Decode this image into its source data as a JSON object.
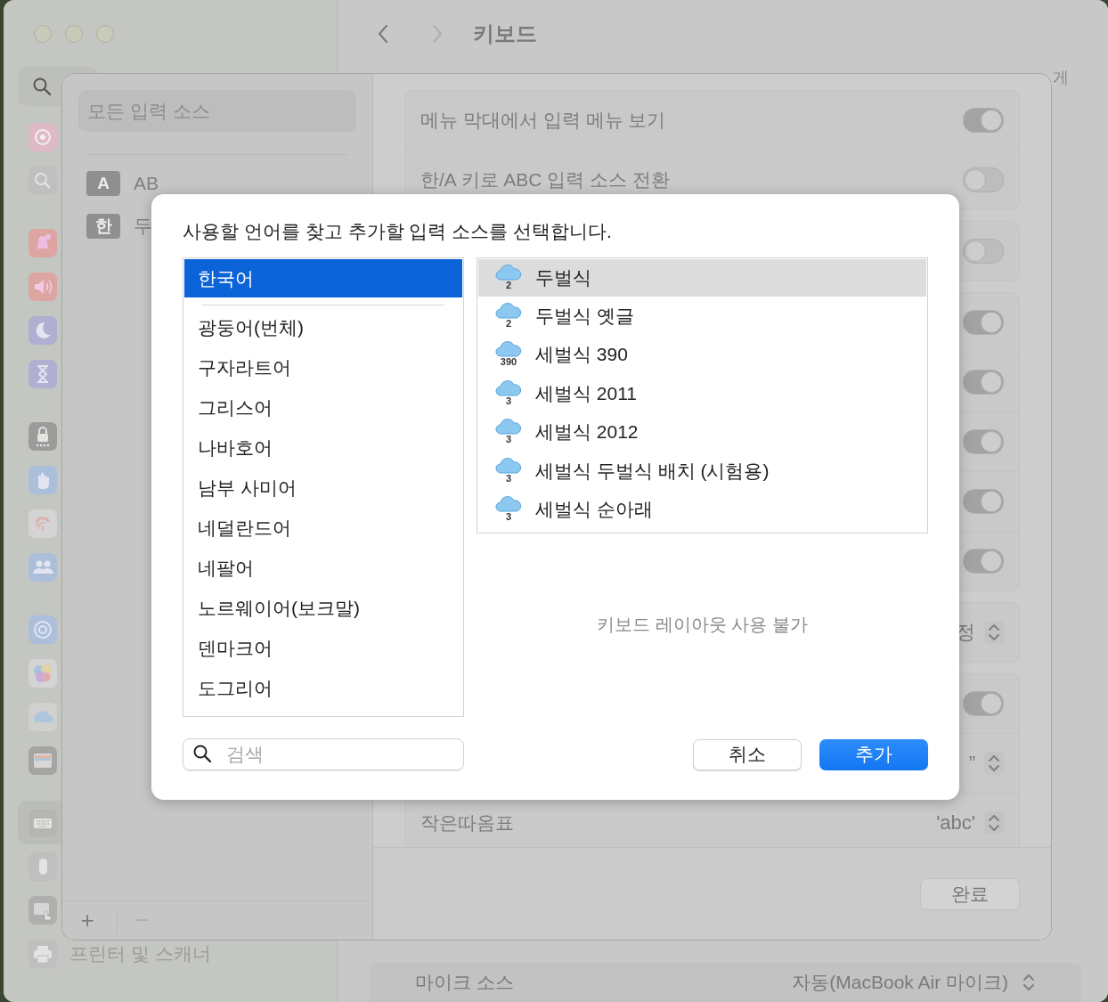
{
  "window": {
    "title": "키보드",
    "back_enabled": true,
    "forward_enabled": false
  },
  "sidebar": {
    "groups": [
      {
        "items": [
          {
            "kind": "siri",
            "selected": false
          },
          {
            "kind": "spotlight",
            "selected": false
          }
        ]
      },
      {
        "items": [
          {
            "kind": "notifications",
            "selected": false
          },
          {
            "kind": "sound",
            "selected": false
          },
          {
            "kind": "focus",
            "selected": false
          },
          {
            "kind": "screentime",
            "selected": false
          }
        ]
      },
      {
        "items": [
          {
            "kind": "lock",
            "selected": false
          },
          {
            "kind": "privacy",
            "selected": false
          },
          {
            "kind": "touchid",
            "selected": false
          },
          {
            "kind": "users",
            "selected": false
          }
        ]
      },
      {
        "items": [
          {
            "kind": "internet",
            "selected": false
          },
          {
            "kind": "gamecenter",
            "selected": false
          },
          {
            "kind": "icloud",
            "selected": false
          },
          {
            "kind": "wallet",
            "selected": false
          }
        ]
      },
      {
        "items": [
          {
            "kind": "keyboard",
            "selected": true
          },
          {
            "kind": "mouse",
            "selected": false
          },
          {
            "kind": "trackpad",
            "selected": false
          },
          {
            "kind": "printer",
            "selected": false,
            "label": "프린터 및 스캐너"
          }
        ]
      }
    ]
  },
  "main": {
    "fragment": "게",
    "rows": [
      {
        "label": "마이크 소스",
        "value": "자동(MacBook Air 마이크)"
      }
    ]
  },
  "sheet": {
    "search": {
      "placeholder": "모든 입력 소스"
    },
    "sources": [
      {
        "badge": "A",
        "name": "AB"
      },
      {
        "badge": "한",
        "name": "두"
      }
    ],
    "add": {
      "label": "+",
      "disabled": false
    },
    "remove": {
      "label": "−",
      "disabled": true
    },
    "groups": [
      {
        "rows": [
          {
            "kind": "toggle",
            "label": "메뉴 막대에서 입력 메뉴 보기",
            "on": true
          },
          {
            "kind": "toggle",
            "label": "한/A 키로 ABC 입력 소스 전환",
            "on": false
          }
        ]
      },
      {
        "rows": [
          {
            "kind": "toggle",
            "on": false
          }
        ]
      },
      {
        "rows": [
          {
            "kind": "toggle",
            "on": true
          },
          {
            "kind": "toggle",
            "on": true
          },
          {
            "kind": "toggle",
            "on": true
          },
          {
            "kind": "toggle",
            "on": true
          },
          {
            "kind": "toggle",
            "on": true
          }
        ]
      },
      {
        "rows": [
          {
            "kind": "popup",
            "value": "정"
          }
        ]
      },
      {
        "rows": [
          {
            "kind": "toggle",
            "on": true
          },
          {
            "kind": "popup",
            "value": "”"
          },
          {
            "kind": "popup",
            "label": "작은따옴표",
            "value": "'abc'"
          }
        ]
      }
    ],
    "done": "완료"
  },
  "dialog": {
    "prompt": "사용할 언어를 찾고 추가할 입력 소스를 선택합니다.",
    "language_groups": [
      {
        "items": [
          {
            "label": "한국어",
            "selected": true
          }
        ]
      },
      {
        "items": [
          {
            "label": "광둥어(번체)",
            "selected": false
          },
          {
            "label": "구자라트어",
            "selected": false
          },
          {
            "label": "그리스어",
            "selected": false
          },
          {
            "label": "나바호어",
            "selected": false
          },
          {
            "label": "남부 사미어",
            "selected": false
          },
          {
            "label": "네덜란드어",
            "selected": false
          },
          {
            "label": "네팔어",
            "selected": false
          },
          {
            "label": "노르웨이어(보크말)",
            "selected": false
          },
          {
            "label": "덴마크어",
            "selected": false
          },
          {
            "label": "도그리어",
            "selected": false
          }
        ]
      }
    ],
    "sources": [
      {
        "number": "2",
        "label": "두벌식",
        "selected": true
      },
      {
        "number": "2",
        "label": "두벌식 옛글",
        "selected": false
      },
      {
        "number": "390",
        "label": "세벌식 390",
        "selected": false
      },
      {
        "number": "3",
        "label": "세벌식 2011",
        "selected": false
      },
      {
        "number": "3",
        "label": "세벌식 2012",
        "selected": false
      },
      {
        "number": "3",
        "label": "세벌식 두벌식 배치 (시험용)",
        "selected": false
      },
      {
        "number": "3",
        "label": "세벌식 순아래",
        "selected": false
      }
    ],
    "empty_note": "키보드 레이아웃 사용 불가",
    "search": {
      "placeholder": "검색"
    },
    "buttons": [
      {
        "label": "취소",
        "kind": "secondary"
      },
      {
        "label": "추가",
        "kind": "primary"
      }
    ]
  }
}
